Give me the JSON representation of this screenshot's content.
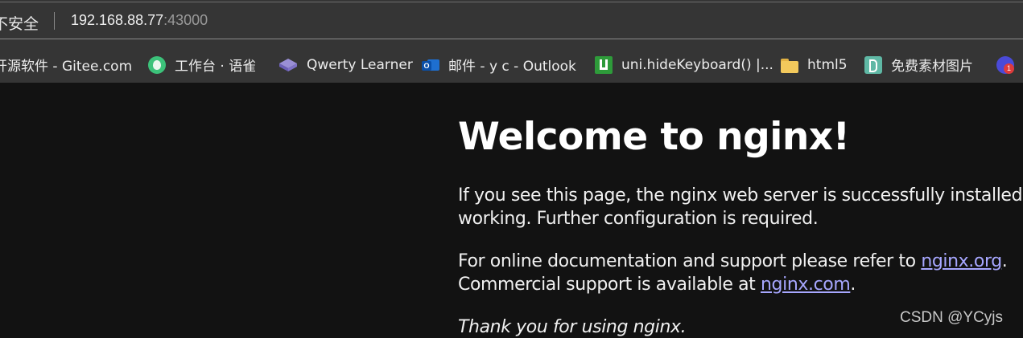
{
  "address_bar": {
    "security_label": "不安全",
    "url_host": "192.168.88.77",
    "url_port": ":43000"
  },
  "bookmarks": [
    {
      "label": "开源软件 - Gitee.com",
      "icon": "none"
    },
    {
      "label": "工作台 · 语雀",
      "icon": "yuque-icon"
    },
    {
      "label": "Qwerty Learner",
      "icon": "keyboard-icon"
    },
    {
      "label": "邮件 - y c - Outlook",
      "icon": "outlook-icon"
    },
    {
      "label": "uni.hideKeyboard() |...",
      "icon": "uniapp-icon"
    },
    {
      "label": "html5",
      "icon": "folder-icon"
    },
    {
      "label": "免费素材图片",
      "icon": "sucai-icon"
    },
    {
      "label": "",
      "icon": "extension-icon",
      "badge": "1"
    }
  ],
  "page": {
    "title": "Welcome to nginx!",
    "para1_line1": "If you see this page, the nginx web server is successfully installed and",
    "para1_line2": "working. Further configuration is required.",
    "para2_line1_before": "For online documentation and support please refer to ",
    "para2_link1": "nginx.org",
    "para2_line1_after": ".",
    "para2_line2_before": "Commercial support is available at ",
    "para2_link2": "nginx.com",
    "para2_line2_after": ".",
    "thanks": "Thank you for using nginx."
  },
  "watermark": "CSDN @YCyjs",
  "colors": {
    "page_background": "#121212",
    "chrome_background": "#353535",
    "link": "#a7a7ff"
  }
}
